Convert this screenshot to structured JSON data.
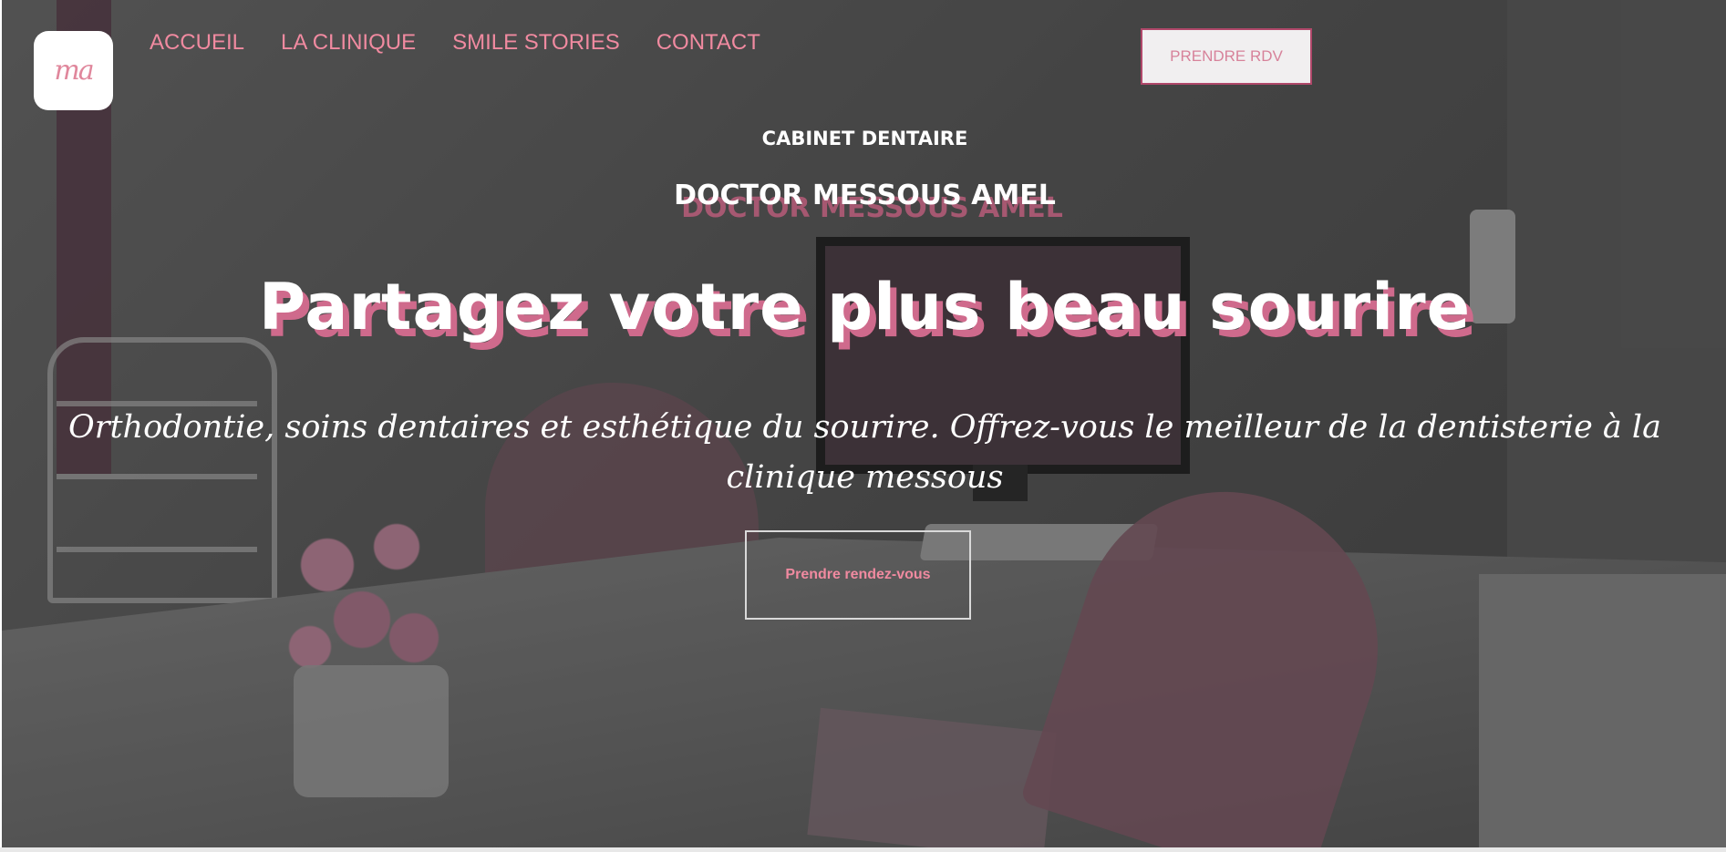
{
  "brand": {
    "logo_text": "ma",
    "accent": "#f08aa0",
    "shadow_pink": "#cf6a8c"
  },
  "nav": {
    "items": [
      {
        "label": "ACCUEIL"
      },
      {
        "label": "LA CLINIQUE"
      },
      {
        "label": "SMILE STORIES"
      },
      {
        "label": "CONTACT"
      }
    ],
    "cta_label": "PRENDRE RDV"
  },
  "hero": {
    "kicker": "CABINET DENTAIRE",
    "doctor_name": "DOCTOR MESSOUS AMEL",
    "headline": "Partagez votre plus beau sourire",
    "subtitle": "Orthodontie, soins dentaires et esthétique du sourire. Offrez-vous le meilleur de la dentisterie à la clinique messous",
    "cta_label": "Prendre rendez-vous"
  }
}
